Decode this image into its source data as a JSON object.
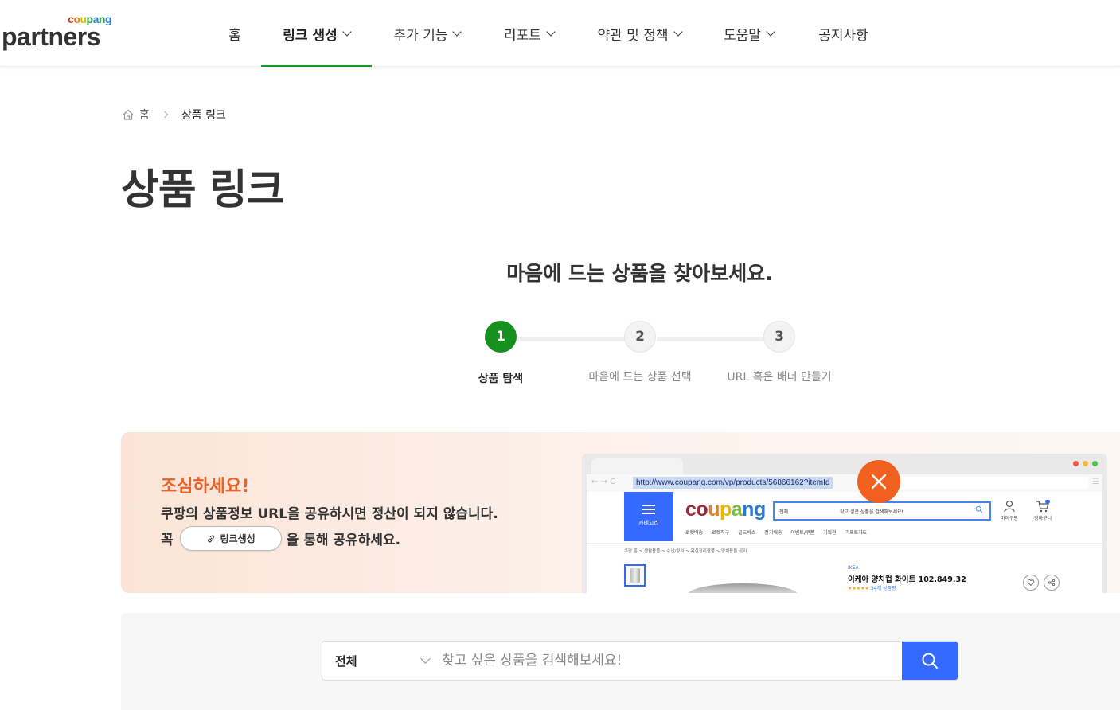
{
  "header": {
    "logo_small": [
      "c",
      "o",
      "u",
      "p",
      "a",
      "n",
      "g"
    ],
    "logo_small_colors": [
      "#c0392b",
      "#e67e22",
      "#e6b800",
      "#1f9c3e",
      "#2b7bd6",
      "#1f9c3e",
      "#2b7bd6"
    ],
    "logo_big": "partners",
    "nav": [
      {
        "label": "홈",
        "has_chevron": false,
        "active": false
      },
      {
        "label": "링크 생성",
        "has_chevron": true,
        "active": true
      },
      {
        "label": "추가 기능",
        "has_chevron": true,
        "active": false
      },
      {
        "label": "리포트",
        "has_chevron": true,
        "active": false
      },
      {
        "label": "약관 및 정책",
        "has_chevron": true,
        "active": false
      },
      {
        "label": "도움말",
        "has_chevron": true,
        "active": false
      },
      {
        "label": "공지사항",
        "has_chevron": false,
        "active": false
      }
    ]
  },
  "breadcrumb": {
    "home": "홈",
    "current": "상품 링크"
  },
  "page_title": "상품 링크",
  "section_title": "마음에 드는 상품을 찾아보세요.",
  "steps": [
    {
      "number": "1",
      "label": "상품 탐색",
      "active": true
    },
    {
      "number": "2",
      "label": "마음에 드는 상품 선택",
      "active": false
    },
    {
      "number": "3",
      "label": "URL 혹은 배너 만들기",
      "active": false
    }
  ],
  "warning": {
    "title": "조심하세요!",
    "line1": "쿠팡의 상품정보 URL을 공유하시면 정산이 되지 않습니다.",
    "line2_prefix": "꼭",
    "pill_label": "링크생성",
    "line2_suffix": "을 통해 공유하세요."
  },
  "mock_browser": {
    "url": "http://www.coupang.com/vp/products/56866162?itemId",
    "category_label": "카테고리",
    "logo_letters": [
      "c",
      "o",
      "u",
      "p",
      "a",
      "n",
      "g"
    ],
    "logo_colors": [
      "#a4243b",
      "#a4243b",
      "#e67e22",
      "#e6b800",
      "#7cba3d",
      "#2b7bd6",
      "#2b7bd6"
    ],
    "search_select": "전체",
    "search_placeholder": "찾고 싶은 상품을 검색해보세요!",
    "icons": [
      "마이쿠팡",
      "장바구니"
    ],
    "subnav": [
      "로켓배송",
      "로켓직구",
      "골드박스",
      "정기배송",
      "이벤트/쿠폰",
      "기획전",
      "기프트카드"
    ],
    "crumb": "쿠팡 홈 > 생활용품 > 수납/정리 > 욕실정리용품 > 양치용품 정리",
    "brand": "IKEA",
    "product_name": "이케아 양치컵 화이트 102.849.32",
    "stars": "★★★★★",
    "reviews": "34개 상품평"
  },
  "search": {
    "category": "전체",
    "placeholder": "찾고 싶은 상품을 검색해보세요!",
    "accent": "#346aff"
  }
}
